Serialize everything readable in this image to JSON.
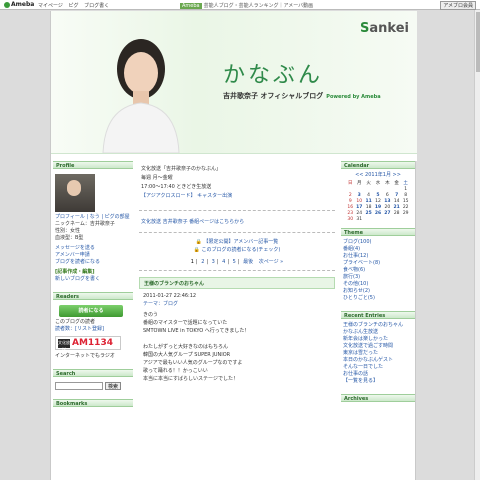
{
  "topbar": {
    "logo": "Ameba",
    "nav": [
      "マイページ",
      "ピグ",
      "ブログ書く"
    ],
    "promo_tag": "Ameba",
    "promo": "芸能人ブログ・芸能人ランキング｜アメーバ動画",
    "ad_button": "アメブロ会員"
  },
  "header": {
    "brand_main": "S",
    "brand_rest": "ankei",
    "title": "かなぶん",
    "subtitle": "吉井歌奈子 オフィシャルブログ",
    "powered": "Powered by Ameba"
  },
  "profile": {
    "heading": "Profile",
    "links": "プロフィール | なう | ピグの部屋",
    "info": [
      "ニックネーム：吉井歌奈子",
      "性別：女性",
      "血液型：B型"
    ],
    "actions": [
      "メッセージを送る",
      "アメンバー申請",
      "ブログを読者になる"
    ],
    "promo_title": "[記事作成・編集]",
    "promo_sub": "新しいブログを書く"
  },
  "readers": {
    "heading": "Readers",
    "button": "読者になる",
    "text1": "このブログの読者",
    "text2": "読者数：[リスト登録]",
    "station": "文化放送",
    "station_freq": "AM1134",
    "station_sub": "インターネットでもラジオ"
  },
  "search": {
    "heading": "Search",
    "button": "検索"
  },
  "bookmarks": {
    "heading": "Bookmarks"
  },
  "main": {
    "lines": [
      "文化放送「吉井歌奈子のかなぶん」",
      "毎週 月〜金曜",
      "17:00〜17:40 ときどき生放送",
      "【アジアクロスロード】 キャスター出演"
    ],
    "links": "文化放送 吉井歌奈子 番組ページはこちらから",
    "member_link": "【限定公開】アメンバー記事一覧",
    "member_note": "このブログの読者になる(チェック)",
    "pager": [
      "1",
      "2",
      "3",
      "4",
      "5",
      "最後",
      "次ページ »"
    ],
    "post": {
      "title": "王様のブランチのおちゃん",
      "date": "2011-01-27 22:46:12",
      "theme": "テーマ：ブログ",
      "body": [
        "きのう",
        "番組のマイスターで話題になっていた",
        "SMTOWN LIVE in TOKYO へ行ってきました！",
        "",
        "わたしがずっと大好きなのはもちろん",
        "韓国の大人気グループ SUPER JUNIOR",
        "アジアで最もいい人気のグループなのですよ",
        "歌って踊れる！！かっこいい",
        "本当に本当にすばらしいステージでした！"
      ]
    }
  },
  "calendar": {
    "heading": "Calendar",
    "month": "<< 2011年1月 >>",
    "days": [
      "日",
      "月",
      "火",
      "水",
      "木",
      "金",
      "土"
    ],
    "rows": [
      [
        "",
        "",
        "",
        "",
        "",
        "",
        "1"
      ],
      [
        "2",
        "3",
        "4",
        "5",
        "6",
        "7",
        "8"
      ],
      [
        "9",
        "10",
        "11",
        "12",
        "13",
        "14",
        "15"
      ],
      [
        "16",
        "17",
        "18",
        "19",
        "20",
        "21",
        "22"
      ],
      [
        "23",
        "24",
        "25",
        "26",
        "27",
        "28",
        "29"
      ],
      [
        "30",
        "31",
        "",
        "",
        "",
        "",
        ""
      ]
    ]
  },
  "theme": {
    "heading": "Theme",
    "items": [
      "ブログ(100)",
      "番組(4)",
      "お仕事(12)",
      "プライベート(8)",
      "食べ物(6)",
      "旅行(3)",
      "その他(10)",
      "お知らせ(2)",
      "ひとりごと(5)"
    ]
  },
  "recent": {
    "heading": "Recent Entries",
    "items": [
      "王様のブランチのおちゃん",
      "かなぶん生放送",
      "新年会は楽しかった",
      "文化放送で過ごす時間",
      "東京は雪だった",
      "本日のかなぶんゲスト",
      "そんな一日でした",
      "お仕事の話",
      "【一覧を見る】"
    ]
  },
  "archives": {
    "heading": "Archives"
  }
}
